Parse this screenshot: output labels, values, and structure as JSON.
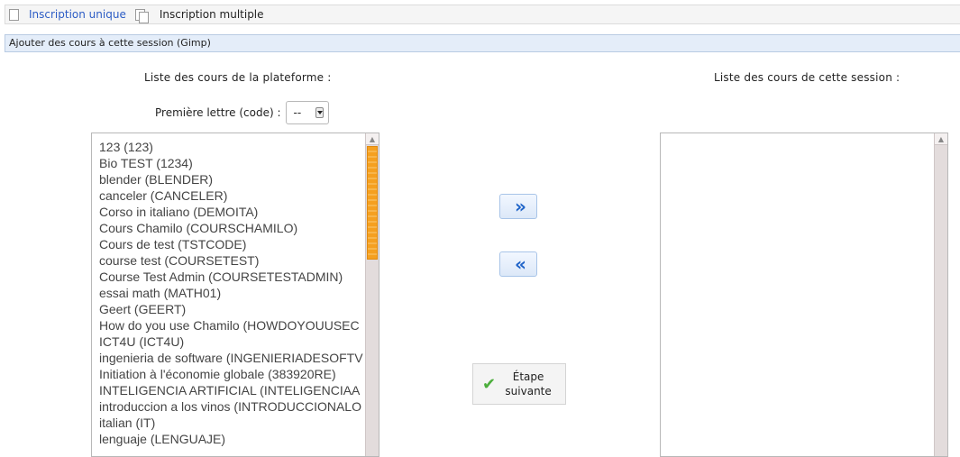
{
  "tabs": [
    {
      "label": "Inscription unique",
      "icon": "document-icon"
    },
    {
      "label": "Inscription multiple",
      "icon": "documents-icon"
    }
  ],
  "section_title": "Ajouter des cours à cette session (Gimp)",
  "left_column": {
    "title": "Liste des cours de la plateforme :",
    "first_letter_label": "Première lettre (code) :",
    "first_letter_value": "--",
    "courses": [
      "123 (123)",
      "Bio TEST (1234)",
      "blender (BLENDER)",
      "canceler (CANCELER)",
      "Corso in italiano (DEMOITA)",
      "Cours Chamilo (COURSCHAMILO)",
      "Cours de test (TSTCODE)",
      "course test (COURSETEST)",
      "Course Test Admin (COURSETESTADMIN)",
      "essai math (MATH01)",
      "Geert (GEERT)",
      "How do you use Chamilo (HOWDOYOUUSEC",
      "ICT4U (ICT4U)",
      "ingenieria de software (INGENIERIADESOFTV",
      "Initiation à l'économie globale (383920RE)",
      "INTELIGENCIA ARTIFICIAL (INTELIGENCIAA",
      "introduccion a los vinos (INTRODUCCIONALO",
      "italian (IT)",
      "lenguaje (LENGUAJE)"
    ]
  },
  "right_column": {
    "title": "Liste des cours de cette session :",
    "courses": []
  },
  "buttons": {
    "add": "»",
    "remove": "«",
    "next_line1": "Étape",
    "next_line2": "suivante"
  },
  "colors": {
    "link": "#2c5cc5",
    "section_bg": "#e4edf9",
    "scroll_thumb": "#f5a020",
    "arrow": "#1e63c8",
    "check": "#4cae3c"
  }
}
